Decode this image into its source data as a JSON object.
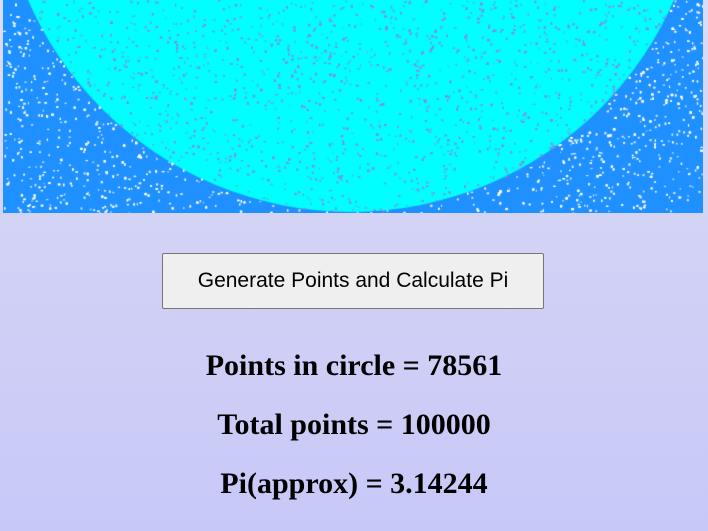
{
  "simulation": {
    "circle_color": "#00ffff",
    "outside_color": "#1e90ff",
    "speckle_color": "#ffffff",
    "inner_speckle_color": "#8a8ad8"
  },
  "controls": {
    "generate_label": "Generate Points and Calculate Pi"
  },
  "results": {
    "inside_text": "Points in circle = 78561",
    "total_text": "Total points = 100000",
    "pi_text": "Pi(approx) = 3.14244"
  }
}
